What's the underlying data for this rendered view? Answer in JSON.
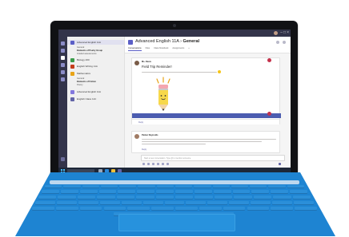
{
  "app": {
    "team_name": "Advanced English 11A",
    "channel_name": "General",
    "tabs": [
      "Conversations",
      "Files",
      "Class Notebook",
      "Assignments",
      "+"
    ]
  },
  "sidebar": {
    "teams": [
      {
        "name": "Advanced English 11A",
        "color": "#5b5fc7",
        "selected": true
      },
      {
        "name": "Biology 200",
        "color": "#3a9c4a",
        "selected": false
      },
      {
        "name": "English Writing 11A",
        "color": "#c43e1c",
        "selected": false
      },
      {
        "name": "Mathematics",
        "color": "#e8a317",
        "selected": false
      },
      {
        "name": "Advanced English 11A",
        "color": "#8378de",
        "selected": false
      },
      {
        "name": "English Class 11C",
        "color": "#6264a7",
        "selected": false
      }
    ],
    "channels": [
      "General",
      "Elements of Poetry Group",
      "Graded assessments",
      "General",
      "Elements of Fiction",
      "Poetry"
    ]
  },
  "posts": [
    {
      "author": "Ms. Davis",
      "title": "Field Trip Reminder!",
      "reply": "Reply"
    },
    {
      "author": "Parker Reynolds",
      "reply": "Reply"
    }
  ],
  "compose": {
    "placeholder": "Start a new conversation. Type @ to mention someone."
  },
  "icons": {
    "rail": [
      "activity-icon",
      "chat-icon",
      "teams-icon",
      "assignments-icon",
      "calendar-icon",
      "files-icon"
    ],
    "illustration": "pencil-mascot-icon"
  },
  "colors": {
    "teams_purple": "#5b5fc7",
    "rail_bg": "#33344a",
    "keyboard_blue": "#1e84d2",
    "taskbar": "#1d2738"
  }
}
